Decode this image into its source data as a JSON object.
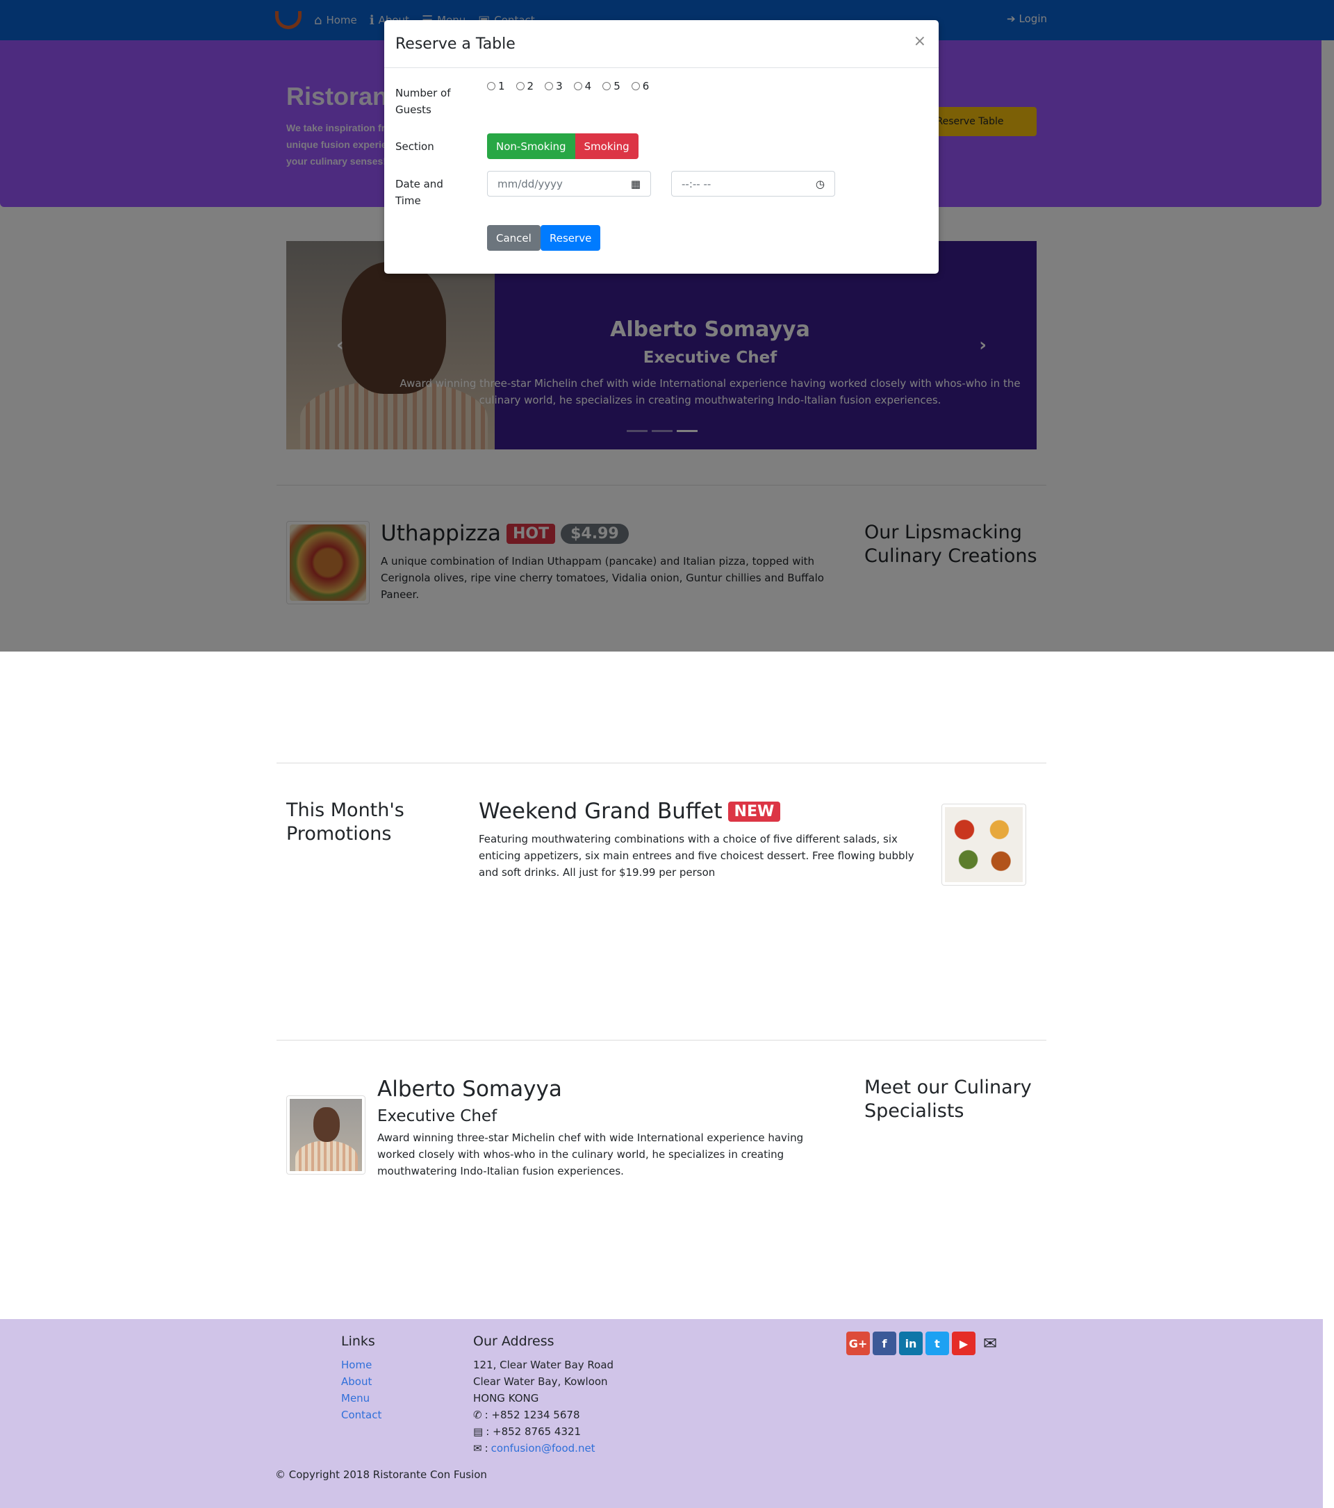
{
  "navbar": {
    "items": [
      {
        "label": "Home",
        "icon": "home-icon"
      },
      {
        "label": "About",
        "icon": "info-icon"
      },
      {
        "label": "Menu",
        "icon": "list-icon"
      },
      {
        "label": "Contact",
        "icon": "address-card-icon"
      }
    ],
    "login_label": "Login"
  },
  "jumbotron": {
    "title": "Ristorante con Fusion",
    "text": "We take inspiration from the World's best cuisines, and create a unique fusion experience. Our lipsmacking creations will tickle your culinary senses!",
    "button_label": "Reserve Table"
  },
  "carousel": {
    "name": "Alberto Somayya",
    "role": "Executive Chef",
    "description": "Award winning three-star Michelin chef with wide International experience having worked closely with whos-who in the culinary world, he specializes in creating mouthwatering Indo-Italian fusion experiences.",
    "active_index": 2,
    "slide_count": 3
  },
  "dish": {
    "title": "Uthappizza",
    "badge": "HOT",
    "price": "$4.99",
    "description": "A unique combination of Indian Uthappam (pancake) and Italian pizza, topped with Cerignola olives, ripe vine cherry tomatoes, Vidalia onion, Guntur chillies and Buffalo Paneer.",
    "side_title": "Our Lipsmacking Culinary Creations"
  },
  "promotion": {
    "side_title": "This Month's Promotions",
    "title": "Weekend Grand Buffet",
    "badge": "NEW",
    "description": "Featuring mouthwatering combinations with a choice of five different salads, six enticing appetizers, six main entrees and five choicest dessert. Free flowing bubbly and soft drinks. All just for $19.99 per person"
  },
  "leader": {
    "name": "Alberto Somayya",
    "role": "Executive Chef",
    "description": "Award winning three-star Michelin chef with wide International experience having worked closely with whos-who in the culinary world, he specializes in creating mouthwatering Indo-Italian fusion experiences.",
    "side_title": "Meet our Culinary Specialists"
  },
  "modal": {
    "title": "Reserve a Table",
    "close_label": "×",
    "guests_label": "Number of Guests",
    "guest_options": [
      "1",
      "2",
      "3",
      "4",
      "5",
      "6"
    ],
    "section_label": "Section",
    "section_options": [
      "Non-Smoking",
      "Smoking"
    ],
    "datetime_label": "Date and Time",
    "date_placeholder": "mm/dd/yyyy",
    "time_placeholder": "--:-- --",
    "cancel_label": "Cancel",
    "reserve_label": "Reserve"
  },
  "footer": {
    "links_title": "Links",
    "links": [
      "Home",
      "About",
      "Menu",
      "Contact"
    ],
    "address_title": "Our Address",
    "address_lines": [
      "121, Clear Water Bay Road",
      "Clear Water Bay, Kowloon",
      "HONG KONG"
    ],
    "phone": ": +852 1234 5678",
    "fax": ": +852 8765 4321",
    "email": "confusion@food.net",
    "socials": [
      "google-plus",
      "facebook",
      "linkedin",
      "twitter",
      "youtube",
      "mail"
    ],
    "copyright": "© Copyright 2018 Ristorante Con Fusion"
  },
  "colors": {
    "navbar": "#0962d2",
    "jumbotron": "#9a56ff",
    "footer": "#d0c4e8",
    "non_smoking": "#28a745",
    "smoking": "#dc3545",
    "primary": "#007bff"
  }
}
